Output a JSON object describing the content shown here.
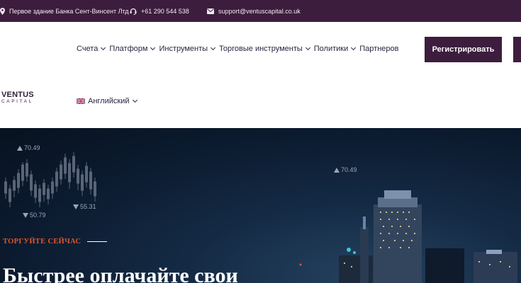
{
  "topbar": {
    "address": "Первое здание Банка Сент-Винсент Лтд",
    "phone": "+61 290 544 538",
    "email": "support@ventuscapital.co.uk",
    "icons": [
      "location-pin-icon",
      "headset-icon",
      "envelope-icon"
    ]
  },
  "header": {
    "logo": {
      "main": "VENTUS",
      "sub": "CAPITAL"
    },
    "nav": [
      {
        "label": "Счета",
        "has_dropdown": true
      },
      {
        "label": "Платформ",
        "has_dropdown": true
      },
      {
        "label": "Инструменты",
        "has_dropdown": true
      },
      {
        "label": "Торговые инструменты",
        "has_dropdown": true
      },
      {
        "label": "Политики",
        "has_dropdown": true
      },
      {
        "label": "Партнеров",
        "has_dropdown": false
      }
    ],
    "register_label": "Регистрировать",
    "language": {
      "label": "Английский",
      "flag": "uk-flag-icon"
    }
  },
  "hero": {
    "quotes": [
      "70.49",
      "50.79",
      "55.31",
      "70.49"
    ],
    "tagline": "ТОРГУЙТЕ СЕЙЧАС",
    "title": "Быстрее оплачайте свои"
  },
  "colors": {
    "brand": "#3d1d3d",
    "accent": "#e0562a",
    "nav_text": "#2b2440",
    "hero_bg": "#0b1a2e"
  }
}
